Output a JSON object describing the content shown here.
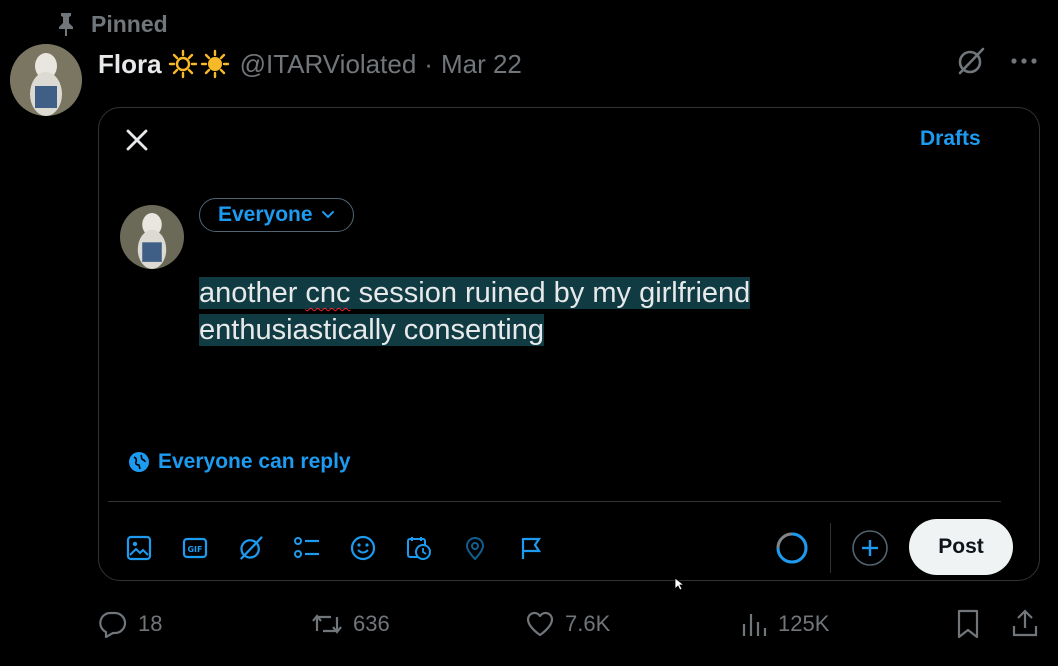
{
  "pinned": {
    "label": "Pinned",
    "icon": "pin-icon"
  },
  "tweet": {
    "author_name": "Flora",
    "name_emoji": "☀️☀️",
    "handle": "@ITARViolated",
    "separator": "·",
    "date": "Mar 22",
    "header_actions": [
      "grok-icon",
      "more-icon"
    ]
  },
  "compose": {
    "drafts_label": "Drafts",
    "audience_label": "Everyone",
    "text_line1_pre": "another ",
    "text_line1_misspelled": "cnc",
    "text_line1_post": " session ruined by my girlfriend",
    "text_line2": "enthusiastically consenting",
    "reply_setting": "Everyone can reply",
    "toolbar_icons": [
      "image-icon",
      "gif-icon",
      "grok-icon",
      "poll-icon",
      "emoji-icon",
      "schedule-icon",
      "location-icon",
      "flag-icon"
    ],
    "post_label": "Post",
    "accent_color": "#1d9bf0",
    "highlight_color": "#113b43"
  },
  "engagement": {
    "replies": "18",
    "reposts": "636",
    "likes": "7.6K",
    "views": "125K"
  }
}
